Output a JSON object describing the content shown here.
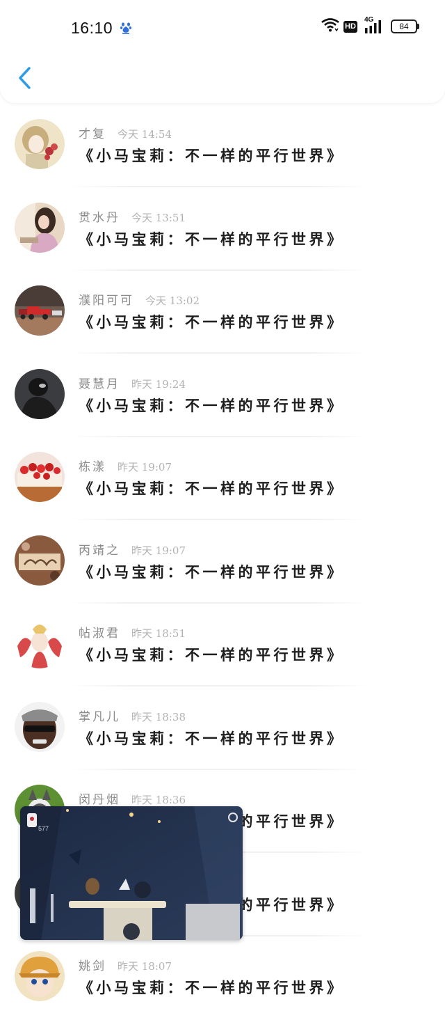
{
  "status": {
    "time": "16:10",
    "battery": "84",
    "network": "4G",
    "hd": "HD"
  },
  "items": [
    {
      "name": "才复",
      "time": "今天 14:54",
      "title": "《小马宝莉：不一样的平行世界》"
    },
    {
      "name": "贯水丹",
      "time": "今天 13:51",
      "title": "《小马宝莉：不一样的平行世界》"
    },
    {
      "name": "濮阳可可",
      "time": "今天 13:02",
      "title": "《小马宝莉：不一样的平行世界》"
    },
    {
      "name": "聂慧月",
      "time": "昨天 19:24",
      "title": "《小马宝莉：不一样的平行世界》"
    },
    {
      "name": "栋漾",
      "time": "昨天 19:07",
      "title": "《小马宝莉：不一样的平行世界》"
    },
    {
      "name": "丙靖之",
      "time": "昨天 19:07",
      "title": "《小马宝莉：不一样的平行世界》"
    },
    {
      "name": "帖淑君",
      "time": "昨天 18:51",
      "title": "《小马宝莉：不一样的平行世界》"
    },
    {
      "name": "掌凡儿",
      "time": "昨天 18:38",
      "title": "《小马宝莉：不一样的平行世界》"
    },
    {
      "name": "闵丹烟",
      "time": "昨天 18:36",
      "title": "《小马宝莉：不一样的平行世界》"
    },
    {
      "name": "",
      "time": "",
      "title": "《小马宝莉：不一样的平行世界》"
    },
    {
      "name": "姚剑",
      "time": "昨天 18:07",
      "title": "《小马宝莉：不一样的平行世界》"
    }
  ],
  "pip": {
    "count": "577"
  },
  "colors": {
    "accent": "#2f9de6",
    "name": "#8c8c8c",
    "time": "#b2b2b2",
    "title": "#1e1e1e"
  }
}
